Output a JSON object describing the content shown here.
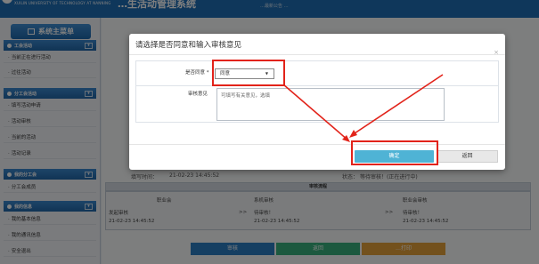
{
  "header": {
    "school": "XUILIN UNIVERSITY OF TECHNOLOGY AT NANNING",
    "title": "…生活动管理系统",
    "right_text": "…最新公告 …"
  },
  "sidebar": {
    "menu_button": "系统主菜单",
    "sections": [
      {
        "title": "工会活动",
        "items": [
          "当前正在进行活动",
          "过往活动"
        ]
      },
      {
        "title": "分工会活动",
        "items": [
          "填写活动申请",
          "活动审核",
          "当前的活动",
          "活动记录"
        ]
      },
      {
        "title": "我的分工会",
        "items": [
          "分工会成员"
        ]
      },
      {
        "title": "我的信息",
        "items": [
          "我的基本信息",
          "我的通讯信息",
          "安全退出"
        ]
      }
    ]
  },
  "background": {
    "fill_time_label": "填写时间：",
    "fill_time_value": "21-02-23 14:45:52",
    "status_label": "状态：",
    "status_value": "等待审核！(正在进行中)",
    "table_title": "审核流程",
    "cols": [
      {
        "title": "职业会",
        "line1": "发起审核",
        "line2": "21-02-23 14:45:52"
      },
      {
        "title": "系机审核",
        "line1": "待审核！",
        "line2": "21-02-23 14:45:52"
      },
      {
        "title": "职业会审核",
        "line1": "待审核！",
        "line2": "21-02-23 14:45:52"
      }
    ],
    "arrow": ">>",
    "bottom_buttons": [
      "审核",
      "返回",
      "…打印"
    ]
  },
  "modal": {
    "title": "请选择是否同意和输入审核意见",
    "close": "×",
    "agree_label": "是否同意 *",
    "agree_value": "同意",
    "opinion_label": "审核意见",
    "opinion_placeholder": "可填写有关意见，选填",
    "ok_label": "确定",
    "back_label": "返回"
  }
}
